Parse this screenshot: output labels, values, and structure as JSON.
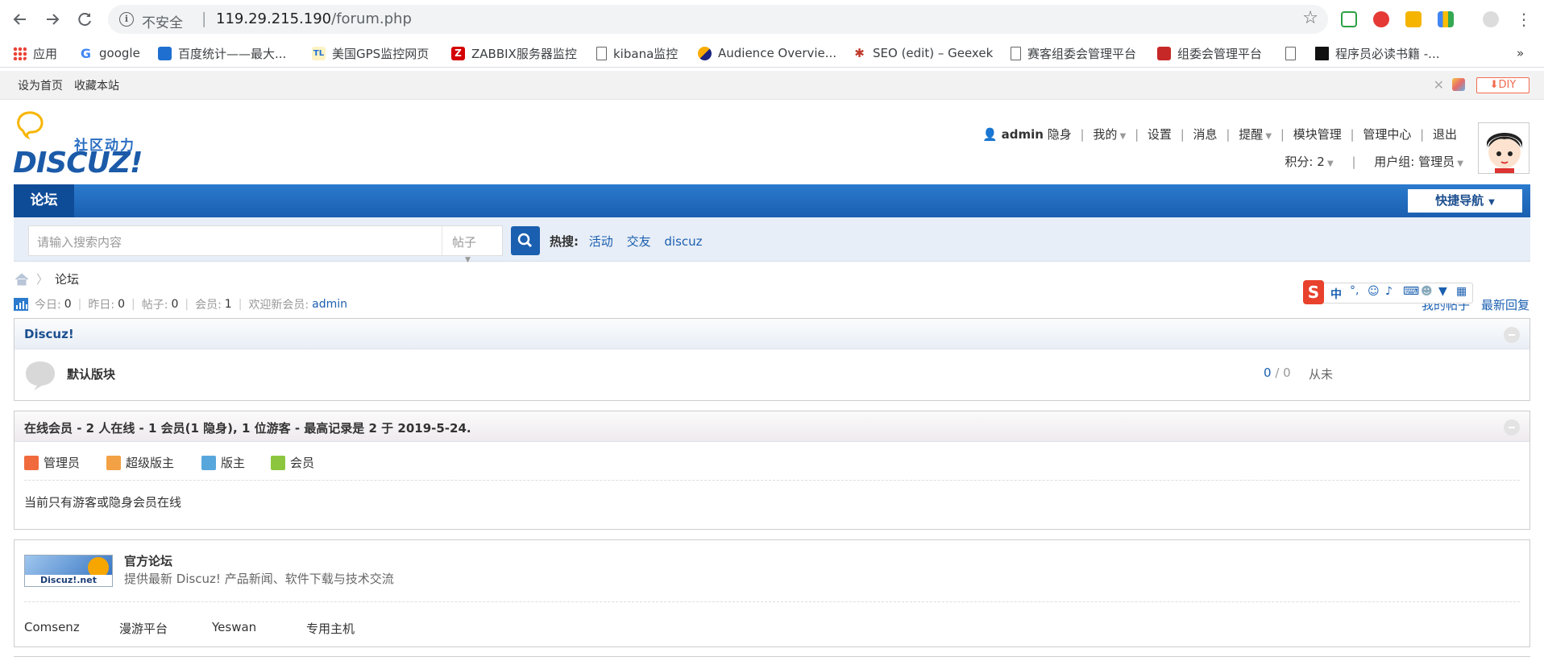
{
  "browser": {
    "insecure_label": "不安全",
    "host": "119.29.215.190",
    "path": "/forum.php",
    "bookmarks": [
      {
        "label": "应用",
        "icon": "apps-grid-icon",
        "color": "#e94235"
      },
      {
        "label": "google",
        "icon": "google-icon",
        "color": "#4285f4"
      },
      {
        "label": "百度统计——最大...",
        "icon": "chart-icon",
        "color": "#1f6fd1"
      },
      {
        "label": "美国GPS监控网页",
        "icon": "tl-icon",
        "color": "#f2b400"
      },
      {
        "label": "ZABBIX服务器监控",
        "icon": "zabbix-icon",
        "color": "#d40000"
      },
      {
        "label": "kibana监控",
        "icon": "page-icon",
        "color": "#666666"
      },
      {
        "label": "Audience Overvie...",
        "icon": "analytics-icon",
        "color": "#e37400"
      },
      {
        "label": "SEO (edit) – Geexek",
        "icon": "paw-icon",
        "color": "#c0392b"
      },
      {
        "label": "赛客组委会管理平台",
        "icon": "page-icon",
        "color": "#666666"
      },
      {
        "label": "组委会管理平台",
        "icon": "red-badge-icon",
        "color": "#c62828"
      },
      {
        "label": "",
        "icon": "page-icon",
        "color": "#666666"
      },
      {
        "label": "程序员必读书籍 -...",
        "icon": "book-icon",
        "color": "#111111"
      }
    ],
    "more": "»"
  },
  "site_top": {
    "set_home": "设为首页",
    "bookmark_site": "收藏本站",
    "diy": "DIY"
  },
  "header": {
    "logo_tagline": "社区动力",
    "logo_text": "DISCUZ!",
    "username": "admin",
    "links": [
      "隐身",
      "我的",
      "设置",
      "消息",
      "提醒",
      "模块管理",
      "管理中心",
      "退出"
    ],
    "points": "积分: 2",
    "usergroup": "用户组: 管理员"
  },
  "nav": {
    "forum": "论坛",
    "quick_nav": "快捷导航"
  },
  "search": {
    "placeholder": "请输入搜索内容",
    "type": "帖子",
    "hot_label": "热搜:",
    "hot": [
      "活动",
      "交友",
      "discuz"
    ]
  },
  "breadcrumb": {
    "current": "论坛"
  },
  "stats": {
    "today_label": "今日:",
    "today": "0",
    "yesterday_label": "昨日:",
    "yesterday": "0",
    "posts_label": "帖子:",
    "posts": "0",
    "members_label": "会员:",
    "members": "1",
    "welcome_label": "欢迎新会员:",
    "newest": "admin",
    "my_posts": "我的帖子",
    "latest_reply": "最新回复"
  },
  "category": {
    "title": "Discuz!",
    "forums": [
      {
        "name": "默认版块",
        "threads": "0",
        "slash": "/",
        "posts": "0",
        "last": "从未"
      }
    ]
  },
  "online": {
    "title": "在线会员 - 2 人在线 - 1 会员(1 隐身), 1 位游客 - 最高记录是 2 于 2019-5-24.",
    "legend": [
      {
        "label": "管理员",
        "color": "#f06a3d"
      },
      {
        "label": "超级版主",
        "color": "#f2a144"
      },
      {
        "label": "版主",
        "color": "#58a7dc"
      },
      {
        "label": "会员",
        "color": "#8cc63f"
      }
    ],
    "notice": "当前只有游客或隐身会员在线"
  },
  "links": {
    "official_title": "官方论坛",
    "official_desc": "提供最新 Discuz! 产品新闻、软件下载与技术交流",
    "badge_text": "Discuz!.net",
    "text_links": [
      "Comsenz",
      "漫游平台",
      "Yeswan",
      "专用主机"
    ]
  },
  "ime": {
    "label": "中"
  }
}
